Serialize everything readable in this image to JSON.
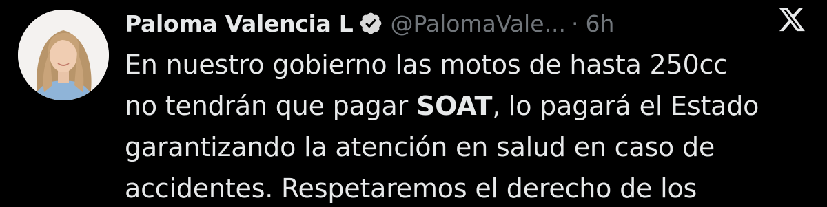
{
  "author": {
    "name": "Paloma Valencia L",
    "handle": "@PalomaVale...",
    "separator": "·",
    "time": "6h",
    "verified_icon": "verified-badge-icon",
    "avatar": "author-avatar-photo"
  },
  "platform": {
    "logo_icon": "x-logo-icon"
  },
  "tweet": {
    "line1": "En nuestro gobierno las motos  de hasta 250cc",
    "line2_before": "no tendrán que pagar ",
    "line2_bold": "SOAT",
    "line2_after": ", lo pagará el Estado",
    "line3": "garantizando la atención en salud en caso de",
    "line4": "accidentes. Respetaremos el derecho de los"
  },
  "colors": {
    "background": "#000000",
    "text": "#e7e9ea",
    "secondary": "#71767b"
  }
}
